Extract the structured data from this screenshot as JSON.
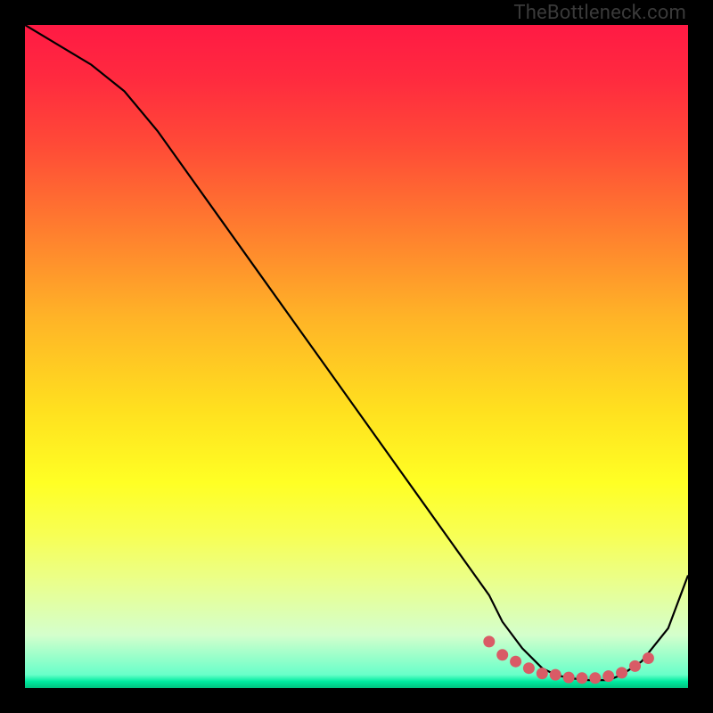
{
  "watermark": {
    "text": "TheBottleneck.com"
  },
  "chart_data": {
    "type": "line",
    "title": "",
    "xlabel": "",
    "ylabel": "",
    "xlim": [
      0,
      100
    ],
    "ylim": [
      0,
      100
    ],
    "grid": false,
    "legend": false,
    "series": [
      {
        "name": "curve",
        "x": [
          0,
          5,
          10,
          15,
          20,
          25,
          30,
          35,
          40,
          45,
          50,
          55,
          60,
          65,
          70,
          72,
          75,
          78,
          80,
          82,
          85,
          88,
          90,
          93,
          97,
          100
        ],
        "y": [
          100,
          97,
          94,
          90,
          84,
          77,
          70,
          63,
          56,
          49,
          42,
          35,
          28,
          21,
          14,
          10,
          6,
          3,
          2,
          1.5,
          1.2,
          1.2,
          2,
          4,
          9,
          17
        ]
      },
      {
        "name": "marker-dots",
        "x": [
          70,
          72,
          74,
          76,
          78,
          80,
          82,
          84,
          86,
          88,
          90,
          92,
          94
        ],
        "y": [
          7,
          5,
          4,
          3,
          2.2,
          2,
          1.6,
          1.5,
          1.5,
          1.8,
          2.3,
          3.3,
          4.5
        ]
      }
    ],
    "colors": {
      "curve": "#000000",
      "dots": "#d95b66"
    }
  }
}
